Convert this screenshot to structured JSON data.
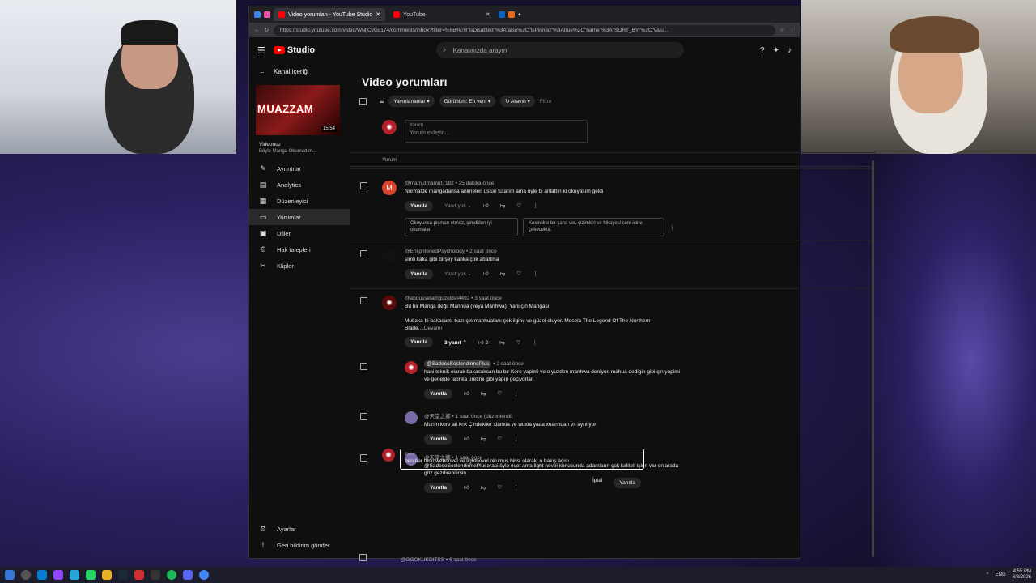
{
  "browser": {
    "tabs": [
      {
        "label": "Video yorumları - YouTube Studio",
        "active": true
      },
      {
        "label": "YouTube",
        "active": false
      }
    ],
    "url": "https://studio.youtube.com/video/WMjCvGc174/comments/inbox?filter=%5B%7B\"isDisabled\"%3Afalse%2C\"isPinned\"%3Atrue%2C\"name\"%3A\"SORT_BY\"%2C\"valu..."
  },
  "header": {
    "logo_text": "Studio",
    "search_placeholder": "Kanalınızda arayın"
  },
  "sidebar": {
    "back_label": "Kanal içeriği",
    "thumb_title": "MUAZZAM",
    "thumb_duration": "15:54",
    "video_title": "Videonuz",
    "video_subtitle": "Böyle Manga Okumadım...",
    "items": [
      {
        "label": "Ayrıntılar",
        "icon": "pencil-icon"
      },
      {
        "label": "Analytics",
        "icon": "analytics-icon"
      },
      {
        "label": "Düzenleyici",
        "icon": "editor-icon"
      },
      {
        "label": "Yorumlar",
        "icon": "comment-icon",
        "active": true
      },
      {
        "label": "Diller",
        "icon": "subtitles-icon"
      },
      {
        "label": "Hak talepleri",
        "icon": "copyright-icon"
      },
      {
        "label": "Klipler",
        "icon": "scissors-icon"
      }
    ],
    "bottom": [
      {
        "label": "Ayarlar",
        "icon": "gear-icon"
      },
      {
        "label": "Geri bildirim gönder",
        "icon": "feedback-icon"
      }
    ]
  },
  "main": {
    "title": "Video yorumları",
    "filters": {
      "published": "Yayınlananlar",
      "view": "Görünüm: En yeni",
      "search": "Arayın",
      "filter_placeholder": "Filtre"
    },
    "add_comment": {
      "label": "Yorum",
      "placeholder": "Yorum ekleyin..."
    },
    "column_header": "Yorum",
    "reply_label": "Yanıtla",
    "no_reply_label": "Yanıt yok",
    "comments": [
      {
        "author": "@mamutmamut7182",
        "time": "25 dakika önce",
        "text": "Normalde mangadansa animeleri üstün tutarım ama öyle bi anlattın ki okuyasım geldi",
        "suggestions": [
          "Okuyunca pişman etmez, şimdiden iyi okumalar.",
          "Kesinlikle bir şans ver, çizimleri ve hikayesi seni içine çekecektir."
        ]
      },
      {
        "author": "@EnlightenedPsychology",
        "time": "2 saat önce",
        "text": "simli kaka gibi birşey kanka çok abartma"
      },
      {
        "author": "@abdusselamguzeldal4492",
        "time": "3 saat önce",
        "text1": "Bu bir Manga değil Manhua (veya Manhwa). Yani çin Mangası.",
        "text2": "Mutlaka bi bakacam, bazı çin manhualarıı çok ilginç ve güzel oluyor. Mesela The Legend Of The Northern Blade....",
        "more": "Devamı",
        "replies_count": "3 yanıt",
        "likes": "2"
      }
    ],
    "replies": [
      {
        "author": "@SadeceSeslendirmePlus",
        "time": "2 saat önce",
        "text": "hani teknik olarak bakacaksan bu bir Kore yapimi ve o yuzden manhwa deniyor, mahua dedigin gibi çin yapimi ve genelde fabrika üretimi gibi yapıp geçiyorlar"
      },
      {
        "author": "@天堂之鄉",
        "time": "1 saat önce (düzenlendi)",
        "text": "Murim kore ait knk Çindekiler xianxia ve wuxia yada xuanhuan vs ayrılıyor"
      },
      {
        "author": "@天堂之鄉",
        "time": "1 saat önce",
        "text": "@SadeceSeslendirmePlusorasi öyle evet ama light novel konusunda adamların çok kaliteli işleri var onlarada göz gezdirebilirsin"
      }
    ],
    "reply_box": {
      "label": "Yanıt",
      "value": "ben her türlü webnovel ve lightnovel okumuş birisi olarak, o bakış açısı"
    },
    "cancel_label": "İptal",
    "submit_label": "Yanıtla",
    "next_author": "@GGOKUEDITSS",
    "next_time": "6 saat önce"
  },
  "taskbar": {
    "lang": "ENG",
    "time": "4:55 PM",
    "date": "8/8/2026"
  }
}
